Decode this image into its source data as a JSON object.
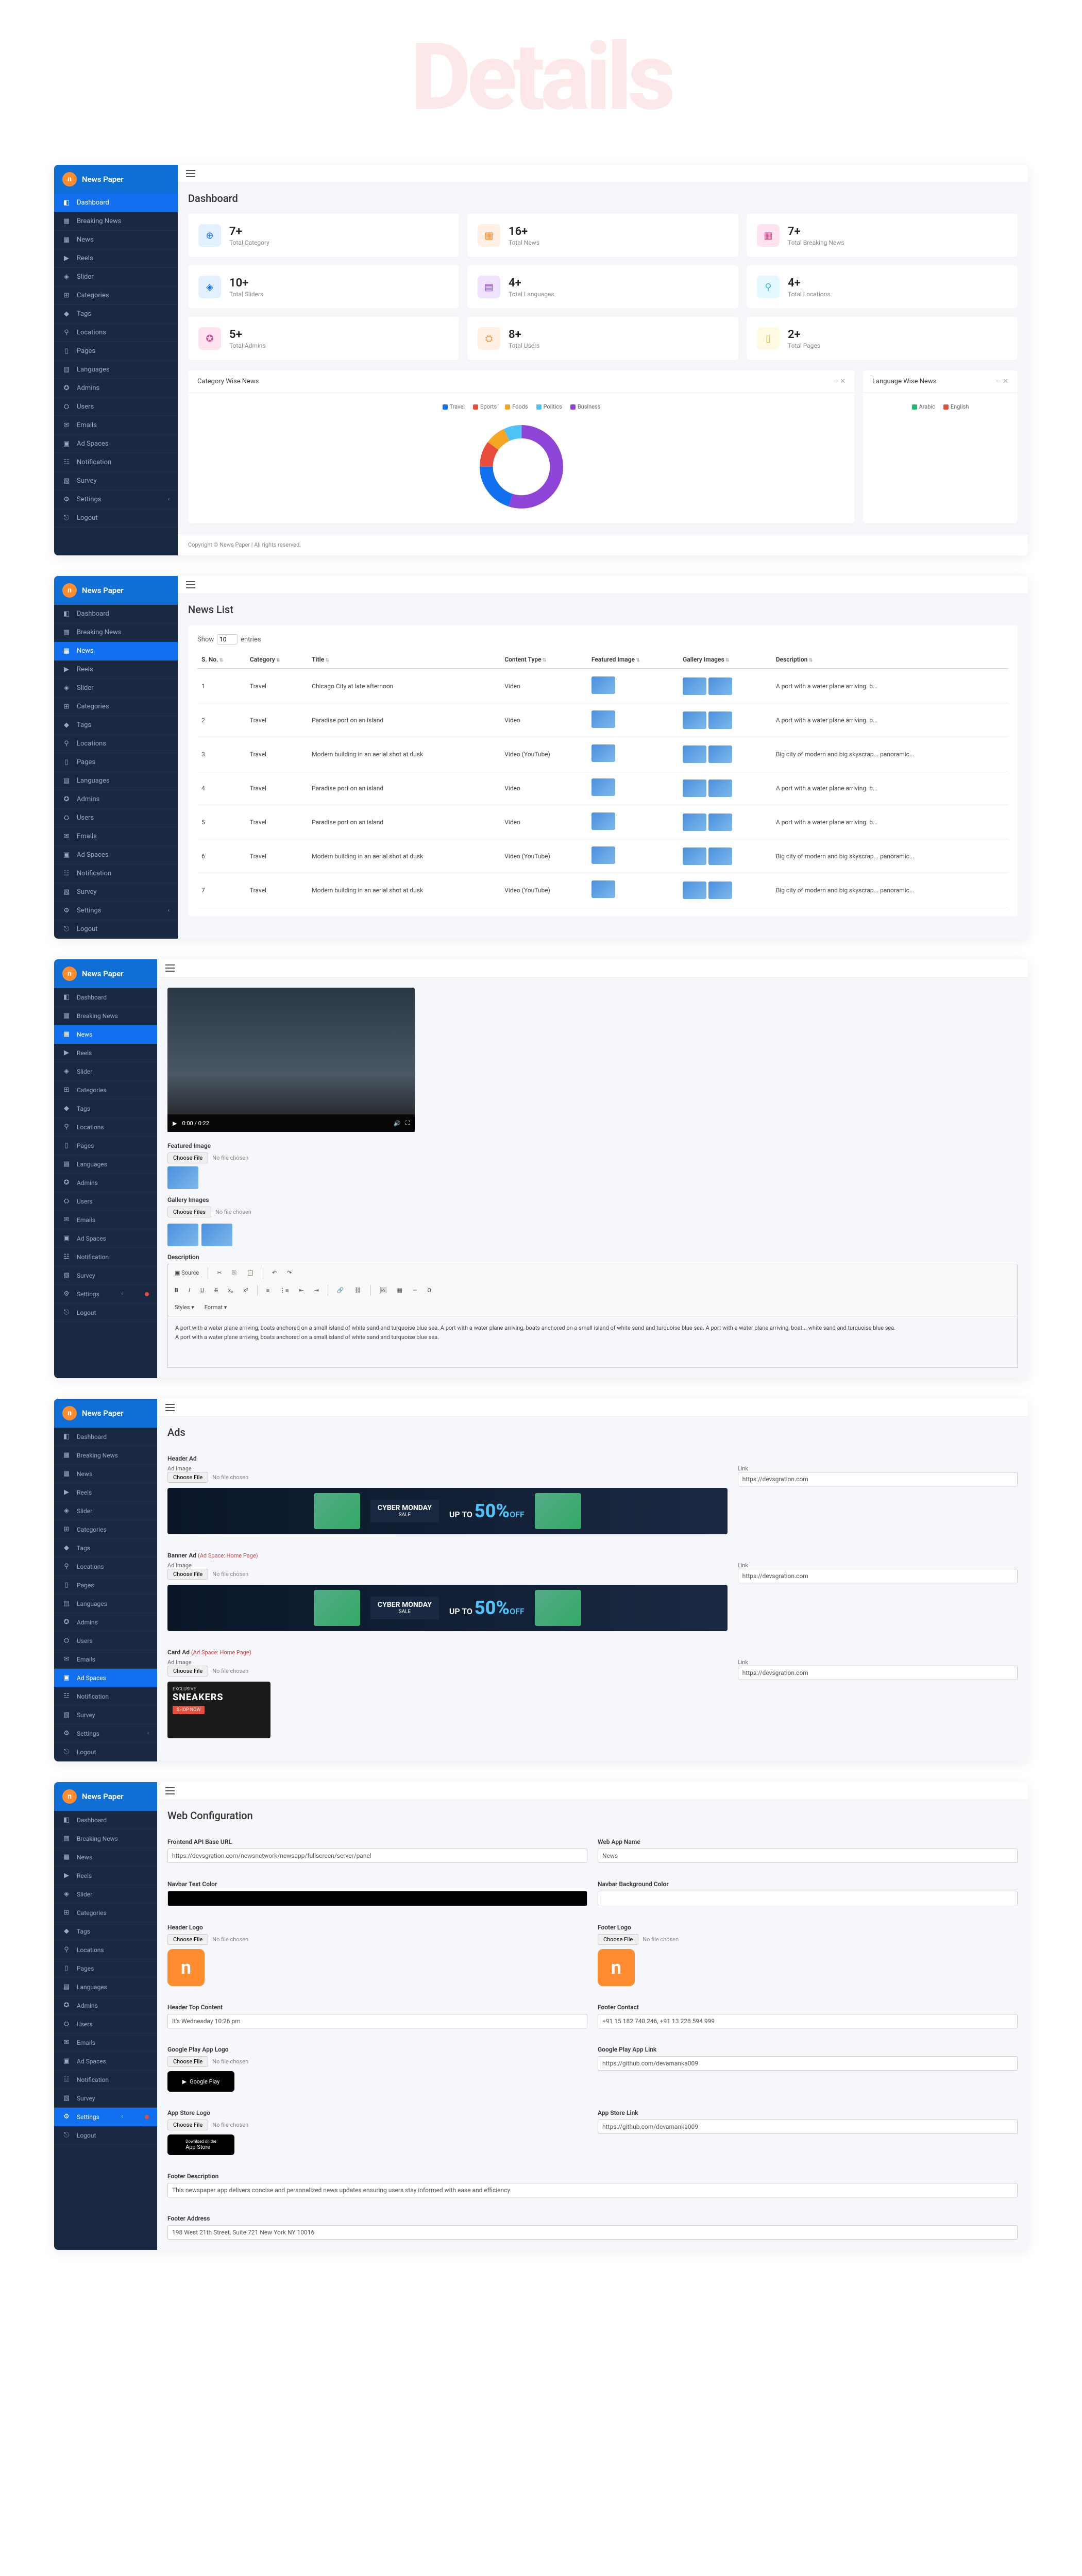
{
  "page_title": "Details",
  "brand": "News Paper",
  "sidebar_items": [
    {
      "icon": "◧",
      "label": "Dashboard",
      "key": "dashboard"
    },
    {
      "icon": "▦",
      "label": "Breaking News",
      "key": "breaking"
    },
    {
      "icon": "▦",
      "label": "News",
      "key": "news"
    },
    {
      "icon": "▶",
      "label": "Reels",
      "key": "reels"
    },
    {
      "icon": "◈",
      "label": "Slider",
      "key": "slider"
    },
    {
      "icon": "⊞",
      "label": "Categories",
      "key": "categories"
    },
    {
      "icon": "◆",
      "label": "Tags",
      "key": "tags"
    },
    {
      "icon": "⚲",
      "label": "Locations",
      "key": "locations"
    },
    {
      "icon": "▯",
      "label": "Pages",
      "key": "pages"
    },
    {
      "icon": "▤",
      "label": "Languages",
      "key": "languages"
    },
    {
      "icon": "✪",
      "label": "Admins",
      "key": "admins"
    },
    {
      "icon": "⛭",
      "label": "Users",
      "key": "users"
    },
    {
      "icon": "✉",
      "label": "Emails",
      "key": "emails"
    },
    {
      "icon": "▣",
      "label": "Ad Spaces",
      "key": "adspaces"
    },
    {
      "icon": "☳",
      "label": "Notification",
      "key": "notification"
    },
    {
      "icon": "▧",
      "label": "Survey",
      "key": "survey"
    },
    {
      "icon": "⚙",
      "label": "Settings",
      "key": "settings",
      "caret": true
    },
    {
      "icon": "⎋",
      "label": "Logout",
      "key": "logout"
    }
  ],
  "dashboard": {
    "header": "Dashboard",
    "stats": [
      {
        "value": "7+",
        "label": "Total Category",
        "cls": "blue",
        "icon": "⊕"
      },
      {
        "value": "16+",
        "label": "Total News",
        "cls": "orange",
        "icon": "▦"
      },
      {
        "value": "7+",
        "label": "Total Breaking News",
        "cls": "pink",
        "icon": "▦"
      },
      {
        "value": "10+",
        "label": "Total Sliders",
        "cls": "blue",
        "icon": "◈"
      },
      {
        "value": "4+",
        "label": "Total Languages",
        "cls": "purple",
        "icon": "▤"
      },
      {
        "value": "4+",
        "label": "Total Locations",
        "cls": "teal",
        "icon": "⚲"
      },
      {
        "value": "5+",
        "label": "Total Admins",
        "cls": "pink",
        "icon": "✪"
      },
      {
        "value": "8+",
        "label": "Total Users",
        "cls": "orange",
        "icon": "⛭"
      },
      {
        "value": "2+",
        "label": "Total Pages",
        "cls": "yellow",
        "icon": "▯"
      }
    ],
    "chart1_title": "Category Wise News",
    "chart2_title": "Language Wise News",
    "legend": [
      "Travel",
      "Sports",
      "Foods",
      "Politics",
      "Business"
    ],
    "legend_colors": [
      "#1170ef",
      "#e94e3c",
      "#f5a623",
      "#4fc3f7",
      "#8e44d6"
    ],
    "lang_legend": [
      "Arabic",
      "English"
    ],
    "lang_colors": [
      "#1fb972",
      "#e94e3c"
    ],
    "footer": "Copyright © News Paper | All rights reserved."
  },
  "chart_data": {
    "type": "pie",
    "title": "Category Wise News",
    "categories": [
      "Travel",
      "Sports",
      "Foods",
      "Politics",
      "Business"
    ],
    "values": [
      20,
      10,
      8,
      7,
      55
    ]
  },
  "newslist": {
    "header": "News List",
    "show": "Show",
    "entries_val": "10",
    "entries": " entries",
    "cols": [
      "S. No.",
      "Category",
      "Title",
      "Content Type",
      "Featured Image",
      "Gallery Images",
      "Description"
    ],
    "rows": [
      {
        "no": "1",
        "cat": "Travel",
        "title": "Chicago City at late afternoon",
        "type": "Video",
        "desc": "A port with a water plane arriving. b..."
      },
      {
        "no": "2",
        "cat": "Travel",
        "title": "Paradise port on an island",
        "type": "Video",
        "desc": "A port with a water plane arriving. b..."
      },
      {
        "no": "3",
        "cat": "Travel",
        "title": "Modern building in an aerial shot at dusk",
        "type": "Video (YouTube)",
        "desc": "Big city of modern and big skyscrap... panoramic..."
      },
      {
        "no": "4",
        "cat": "Travel",
        "title": "Paradise port on an island",
        "type": "Video",
        "desc": "A port with a water plane arriving. b..."
      },
      {
        "no": "5",
        "cat": "Travel",
        "title": "Paradise port on an island",
        "type": "Video",
        "desc": "A port with a water plane arriving. b..."
      },
      {
        "no": "6",
        "cat": "Travel",
        "title": "Modern building in an aerial shot at dusk",
        "type": "Video (YouTube)",
        "desc": "Big city of modern and big skyscrap... panoramic..."
      },
      {
        "no": "7",
        "cat": "Travel",
        "title": "Modern building in an aerial shot at dusk",
        "type": "Video (YouTube)",
        "desc": "Big city of modern and big skyscrap... panoramic..."
      }
    ]
  },
  "editor": {
    "featured_label": "Featured Image",
    "gallery_label": "Gallery Images",
    "desc_label": "Description",
    "choose_file": "Choose File",
    "choose_files": "Choose Files",
    "no_file": "No file chosen",
    "source": "Source",
    "styles": "Styles",
    "format": "Format",
    "video_time": "0:00 / 0:22",
    "body_p1": "A port with a water plane arriving, boats anchored on a small island of white sand and turquoise blue sea. A port with a water plane arriving, boats anchored on a small island of white sand and turquoise blue sea. A port with a water plane arriving, boat... white sand and turquoise blue sea.",
    "body_p2": "A port with a water plane arriving, boats anchored on a small island of white sand and turquoise blue sea."
  },
  "ads": {
    "header": "Ads",
    "header_ad": "Header Ad",
    "banner_ad": "Banner Ad",
    "card_ad": "Card Ad",
    "space_home": "(Ad Space: Home Page)",
    "ad_image": "Ad Image",
    "link": "Link",
    "link_val": "https://devsgration.com",
    "choose_file": "Choose File",
    "no_file": "No file chosen",
    "cyber": "CYBER MONDAY",
    "sale": "SALE",
    "up": "UP TO",
    "pct": "50%",
    "off": "OFF",
    "exclusive": "EXCLUSIVE",
    "sneakers": "SNEAKERS",
    "shop": "SHOP NOW"
  },
  "config": {
    "header": "Web Configuration",
    "api_label": "Frontend API Base URL",
    "api_val": "https://devsgration.com/newsnetwork/newsapp/fullscreen/server/panel",
    "app_name_label": "Web App Name",
    "app_name_val": "News",
    "navbar_text": "Navbar Text Color",
    "navbar_bg": "Navbar Background Color",
    "header_logo": "Header Logo",
    "footer_logo": "Footer Logo",
    "header_top": "Header Top Content",
    "header_top_val": "It's Wednesday 10:26 pm",
    "footer_contact": "Footer Contact",
    "footer_contact_val": "+91 15 182 740 246, +91 13 228 594 999",
    "gplay_logo": "Google Play App Logo",
    "gplay_link": "Google Play App Link",
    "gplay_val": "https://github.com/devamanka009",
    "appstore_logo": "App Store Logo",
    "appstore_link": "App Store Link",
    "appstore_val": "https://github.com/devamanka009",
    "footer_desc": "Footer Description",
    "footer_desc_val": "This newspaper app delivers concise and personalized news updates ensuring users stay informed with ease and efficiency.",
    "footer_addr": "Footer Address",
    "footer_addr_val": "198 West 21th Street, Suite 721 New York NY 10016",
    "choose_file": "Choose File",
    "no_file": "No file chosen",
    "google_play": "Google Play",
    "app_store": "App Store",
    "download": "Download on the"
  }
}
